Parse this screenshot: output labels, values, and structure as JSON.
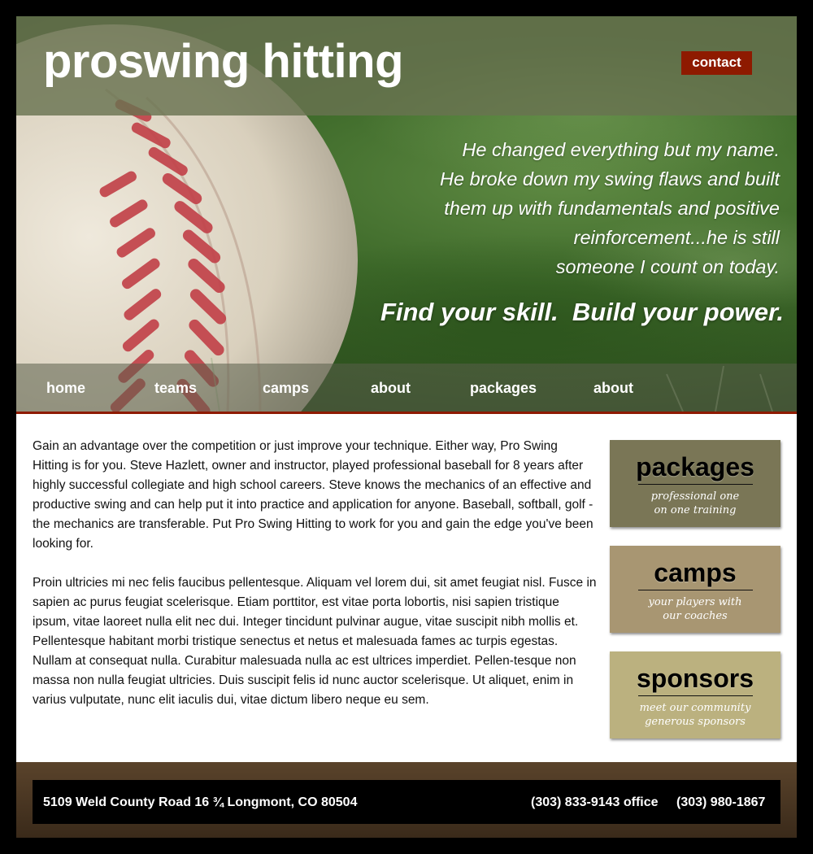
{
  "site": {
    "brand": "proswing hitting",
    "contact_label": "contact"
  },
  "hero": {
    "quote_lines": [
      "He changed everything but my name.",
      "He broke down my swing flaws and built",
      "them up with fundamentals and positive",
      "reinforcement...he is still",
      "someone I count on today."
    ],
    "tagline": "Find your skill.  Build your power."
  },
  "nav": {
    "items": [
      {
        "label": "home"
      },
      {
        "label": "teams"
      },
      {
        "label": "camps"
      },
      {
        "label": "about"
      },
      {
        "label": "packages"
      },
      {
        "label": "about"
      }
    ]
  },
  "main": {
    "paragraph1": "Gain an advantage over the competition or just improve your technique. Either way, Pro Swing Hitting is for you. Steve Hazlett, owner and instructor, played professional baseball for 8 years after highly successful collegiate and high school careers. Steve knows the mechanics of an effective and productive swing and can help put it into practice and application for anyone. Baseball, softball, golf - the mechanics are transferable. Put Pro Swing Hitting to work for you and gain the edge you've been looking for.",
    "paragraph2": "Proin ultricies mi nec felis faucibus pellentesque. Aliquam vel lorem dui, sit amet feugiat nisl. Fusce in sapien ac purus feugiat scelerisque. Etiam porttitor, est vitae porta lobortis, nisi sapien tristique ipsum, vitae laoreet nulla elit nec dui. Integer tincidunt pulvinar augue, vitae suscipit nibh mollis et. Pellentesque habitant morbi tristique senectus et netus et malesuada fames ac turpis egestas. Nullam at consequat nulla. Curabitur malesuada nulla ac est ultrices imperdiet. Pellen-tesque non massa non nulla feugiat ultricies. Duis suscipit felis id nunc auctor scelerisque. Ut aliquet, enim in varius vulputate, nunc elit iaculis dui, vitae dictum libero neque eu sem."
  },
  "sidebar": {
    "boxes": [
      {
        "title": "packages",
        "sub1": "professional one",
        "sub2": "on one training",
        "color": "#7a7656"
      },
      {
        "title": "camps",
        "sub1": "your players with",
        "sub2": "our coaches",
        "color": "#a89672"
      },
      {
        "title": "sponsors",
        "sub1": "meet our community",
        "sub2": "generous sponsors",
        "color": "#bbb17f"
      }
    ]
  },
  "footer": {
    "address": "5109 Weld County Road 16 ¾ Longmont, CO 80504",
    "phone_office": "(303) 833-9143 office",
    "phone_2": "(303) 980-1867"
  },
  "colors": {
    "accent_red": "#8e1a00",
    "top_band": "#69734f",
    "footer_brown": "#4a3622"
  }
}
